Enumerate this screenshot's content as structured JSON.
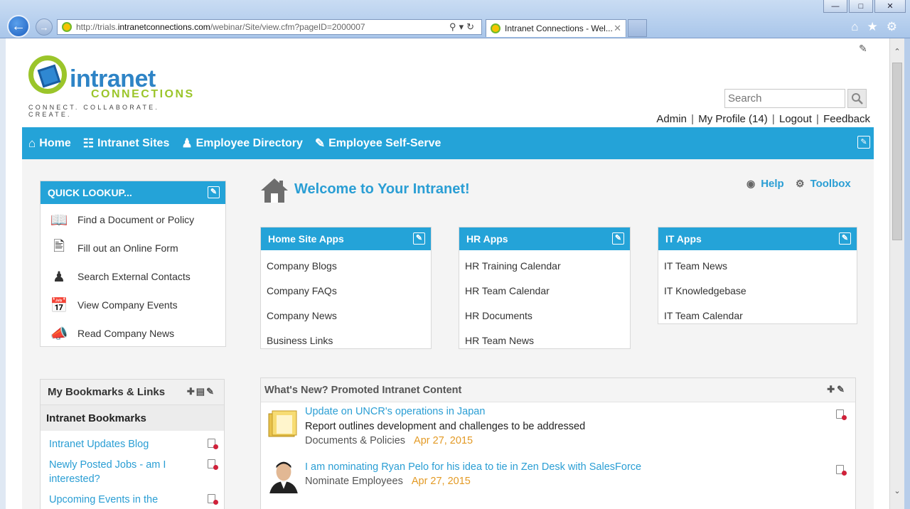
{
  "browser": {
    "url_prefix": "http://trials.",
    "url_host": "intranetconnections.com",
    "url_path": "/webinar/Site/view.cfm?pageID=2000007",
    "tab_title": "Intranet Connections - Wel...",
    "minimize": "—",
    "maximize": "□",
    "close": "✕"
  },
  "logo": {
    "word": "intranet",
    "sub": "CONNECTIONS",
    "tagline": "CONNECT. COLLABORATE. CREATE."
  },
  "search": {
    "placeholder": "Search"
  },
  "user_links": {
    "admin": "Admin",
    "profile": "My Profile (14)",
    "logout": "Logout",
    "feedback": "Feedback",
    "sep": "|"
  },
  "nav": [
    {
      "label": "Home",
      "icon": "home-icon"
    },
    {
      "label": "Intranet Sites",
      "icon": "sitemap-icon"
    },
    {
      "label": "Employee Directory",
      "icon": "people-icon"
    },
    {
      "label": "Employee Self-Serve",
      "icon": "ticket-icon"
    }
  ],
  "quick_lookup": {
    "title": "QUICK LOOKUP...",
    "items": [
      {
        "label": "Find a Document or Policy",
        "icon": "book-icon"
      },
      {
        "label": "Fill out an Online Form",
        "icon": "form-icon"
      },
      {
        "label": "Search External Contacts",
        "icon": "person-icon"
      },
      {
        "label": "View Company Events",
        "icon": "calendar-icon"
      },
      {
        "label": "Read Company News",
        "icon": "megaphone-icon"
      }
    ]
  },
  "welcome": {
    "title": "Welcome to Your Intranet!",
    "help": "Help",
    "toolbox": "Toolbox"
  },
  "app_panels": [
    {
      "title": "Home Site Apps",
      "items": [
        "Company Blogs",
        "Company FAQs",
        "Company News",
        "Business Links"
      ]
    },
    {
      "title": "HR Apps",
      "items": [
        "HR Training Calendar",
        "HR Team Calendar",
        "HR Documents",
        "HR Team News"
      ]
    },
    {
      "title": "IT Apps",
      "items": [
        "IT Team News",
        "IT Knowledgebase",
        "IT Team Calendar"
      ]
    }
  ],
  "bookmarks": {
    "title": "My Bookmarks & Links",
    "subtitle": "Intranet Bookmarks",
    "links": [
      "Intranet Updates Blog",
      "Newly Posted Jobs - am I interested?",
      "Upcoming Events in the"
    ]
  },
  "whats_new": {
    "title": "What's New? Promoted Intranet Content",
    "items": [
      {
        "title": "Update on UNCR's operations in Japan",
        "desc": "Report outlines development and challenges to be addressed",
        "category": "Documents & Policies",
        "date": "Apr 27, 2015"
      },
      {
        "title": "I am nominating Ryan Pelo for his idea to tie in Zen Desk with SalesForce",
        "desc": "",
        "category": "Nominate Employees",
        "date": "Apr 27, 2015"
      }
    ]
  }
}
